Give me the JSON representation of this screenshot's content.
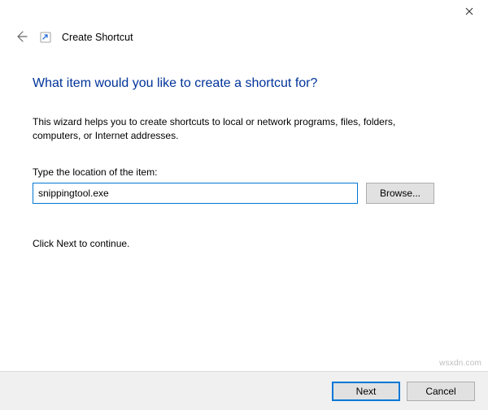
{
  "titlebar": {
    "close_tooltip": "Close"
  },
  "header": {
    "title": "Create Shortcut"
  },
  "content": {
    "heading": "What item would you like to create a shortcut for?",
    "description": "This wizard helps you to create shortcuts to local or network programs, files, folders, computers, or Internet addresses.",
    "location_label": "Type the location of the item:",
    "location_value": "snippingtool.exe",
    "browse_label": "Browse...",
    "hint": "Click Next to continue."
  },
  "footer": {
    "next_label": "Next",
    "cancel_label": "Cancel"
  },
  "watermark": "wsxdn.com"
}
